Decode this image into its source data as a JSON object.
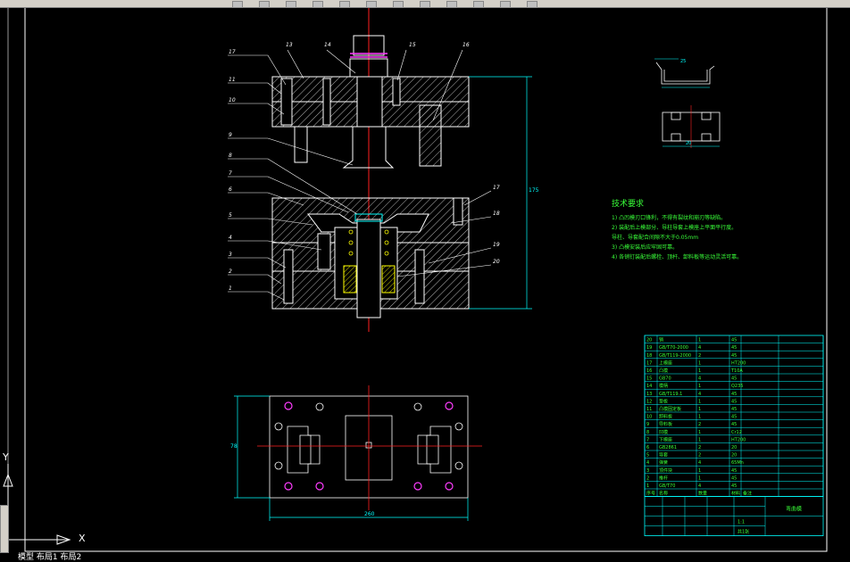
{
  "window": {
    "name": "cad-drawing-viewport"
  },
  "colors": {
    "background": "#000000",
    "frame": "#ffffff",
    "part": "#ffffff",
    "hatch": "#ffff00",
    "centerline": "#ff2020",
    "dimension": "#00ffff",
    "text": "#39ff39",
    "magenta": "#ff3cff",
    "table": "#00ffff"
  },
  "toolbar": {
    "icons": [
      "new-icon",
      "open-icon",
      "save-icon",
      "print-icon",
      "cut-icon",
      "copy-icon",
      "paste-icon",
      "undo-icon",
      "redo-icon",
      "pan-icon",
      "zoom-icon",
      "properties-icon"
    ]
  },
  "tech_requirements": {
    "title": "技术要求",
    "lines": [
      "1) 凸凹模刃口锋利，不得有裂纹和崩刃等缺陷。",
      "2) 装配后上模部分、导柱导套上模座上平面平行度。",
      "   导柱、导套配合间隙不大于0.05mm",
      "3) 凸模安装后应牢固可靠。",
      "4) 各销钉装配后螺栓、顶杆、卸料板等运动灵活可靠。"
    ]
  },
  "balloons": {
    "top_left": [
      "17",
      "11",
      "10",
      "9",
      "8",
      "7",
      "6",
      "5",
      "4",
      "3",
      "2",
      "1"
    ],
    "top_row": [
      "13",
      "14",
      "15",
      "16"
    ],
    "right": [
      "17",
      "18",
      "19",
      "20"
    ]
  },
  "dims": {
    "total_width": "260",
    "height": "175",
    "plan_height": "78",
    "profile_width": "20",
    "profile_width2": "25"
  },
  "ucs": {
    "y_label": "Y",
    "x_label": "X"
  },
  "status_text": "模型  布局1  布局2",
  "bom": {
    "rows": [
      [
        "20",
        "销",
        "1",
        "45",
        ""
      ],
      [
        "19",
        "GB/T70-2000",
        "4",
        "45",
        ""
      ],
      [
        "18",
        "GB/T119-2000",
        "2",
        "45",
        ""
      ],
      [
        "17",
        "上模座",
        "1",
        "HT200",
        ""
      ],
      [
        "16",
        "凸模",
        "1",
        "T10A",
        ""
      ],
      [
        "15",
        "GB70",
        "4",
        "45",
        ""
      ],
      [
        "14",
        "模柄",
        "1",
        "Q235",
        ""
      ],
      [
        "13",
        "GB/T119.1",
        "4",
        "45",
        ""
      ],
      [
        "12",
        "垫板",
        "1",
        "45",
        ""
      ],
      [
        "11",
        "凸模固定板",
        "1",
        "45",
        ""
      ],
      [
        "10",
        "卸料板",
        "1",
        "45",
        ""
      ],
      [
        "9",
        "导料板",
        "2",
        "45",
        ""
      ],
      [
        "8",
        "凹模",
        "1",
        "Cr12",
        ""
      ],
      [
        "7",
        "下模座",
        "1",
        "HT200",
        ""
      ],
      [
        "6",
        "GB2861",
        "2",
        "20",
        ""
      ],
      [
        "5",
        "导套",
        "2",
        "20",
        ""
      ],
      [
        "4",
        "弹簧",
        "4",
        "65Mn",
        ""
      ],
      [
        "3",
        "顶件块",
        "1",
        "45",
        ""
      ],
      [
        "2",
        "推杆",
        "1",
        "45",
        ""
      ],
      [
        "1",
        "GB/T70",
        "4",
        "45",
        ""
      ]
    ],
    "header": [
      "序号",
      "名称",
      "数量",
      "材料",
      "备注"
    ],
    "title_block": {
      "name": "弯曲模",
      "scale": "1:1",
      "sheet": "共1张"
    }
  }
}
